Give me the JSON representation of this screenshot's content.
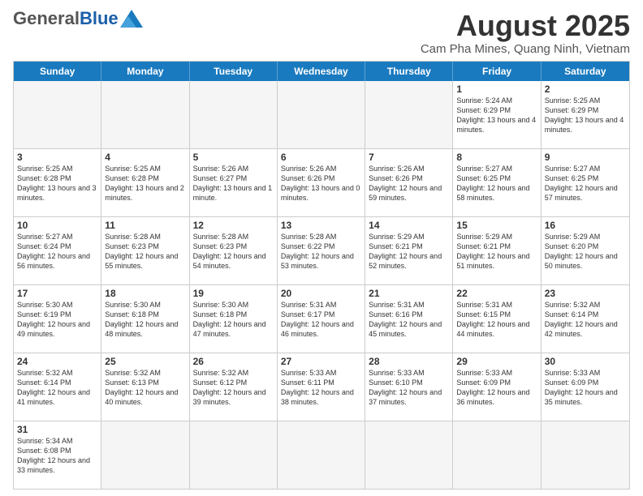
{
  "header": {
    "logo": {
      "general": "General",
      "blue": "Blue"
    },
    "title": "August 2025",
    "location": "Cam Pha Mines, Quang Ninh, Vietnam"
  },
  "calendar": {
    "days_of_week": [
      "Sunday",
      "Monday",
      "Tuesday",
      "Wednesday",
      "Thursday",
      "Friday",
      "Saturday"
    ],
    "weeks": [
      [
        {
          "day": "",
          "info": "",
          "empty": true
        },
        {
          "day": "",
          "info": "",
          "empty": true
        },
        {
          "day": "",
          "info": "",
          "empty": true
        },
        {
          "day": "",
          "info": "",
          "empty": true
        },
        {
          "day": "",
          "info": "",
          "empty": true
        },
        {
          "day": "1",
          "info": "Sunrise: 5:24 AM\nSunset: 6:29 PM\nDaylight: 13 hours\nand 4 minutes.",
          "empty": false
        },
        {
          "day": "2",
          "info": "Sunrise: 5:25 AM\nSunset: 6:29 PM\nDaylight: 13 hours\nand 4 minutes.",
          "empty": false
        }
      ],
      [
        {
          "day": "3",
          "info": "Sunrise: 5:25 AM\nSunset: 6:28 PM\nDaylight: 13 hours\nand 3 minutes.",
          "empty": false
        },
        {
          "day": "4",
          "info": "Sunrise: 5:25 AM\nSunset: 6:28 PM\nDaylight: 13 hours\nand 2 minutes.",
          "empty": false
        },
        {
          "day": "5",
          "info": "Sunrise: 5:26 AM\nSunset: 6:27 PM\nDaylight: 13 hours\nand 1 minute.",
          "empty": false
        },
        {
          "day": "6",
          "info": "Sunrise: 5:26 AM\nSunset: 6:26 PM\nDaylight: 13 hours\nand 0 minutes.",
          "empty": false
        },
        {
          "day": "7",
          "info": "Sunrise: 5:26 AM\nSunset: 6:26 PM\nDaylight: 12 hours\nand 59 minutes.",
          "empty": false
        },
        {
          "day": "8",
          "info": "Sunrise: 5:27 AM\nSunset: 6:25 PM\nDaylight: 12 hours\nand 58 minutes.",
          "empty": false
        },
        {
          "day": "9",
          "info": "Sunrise: 5:27 AM\nSunset: 6:25 PM\nDaylight: 12 hours\nand 57 minutes.",
          "empty": false
        }
      ],
      [
        {
          "day": "10",
          "info": "Sunrise: 5:27 AM\nSunset: 6:24 PM\nDaylight: 12 hours\nand 56 minutes.",
          "empty": false
        },
        {
          "day": "11",
          "info": "Sunrise: 5:28 AM\nSunset: 6:23 PM\nDaylight: 12 hours\nand 55 minutes.",
          "empty": false
        },
        {
          "day": "12",
          "info": "Sunrise: 5:28 AM\nSunset: 6:23 PM\nDaylight: 12 hours\nand 54 minutes.",
          "empty": false
        },
        {
          "day": "13",
          "info": "Sunrise: 5:28 AM\nSunset: 6:22 PM\nDaylight: 12 hours\nand 53 minutes.",
          "empty": false
        },
        {
          "day": "14",
          "info": "Sunrise: 5:29 AM\nSunset: 6:21 PM\nDaylight: 12 hours\nand 52 minutes.",
          "empty": false
        },
        {
          "day": "15",
          "info": "Sunrise: 5:29 AM\nSunset: 6:21 PM\nDaylight: 12 hours\nand 51 minutes.",
          "empty": false
        },
        {
          "day": "16",
          "info": "Sunrise: 5:29 AM\nSunset: 6:20 PM\nDaylight: 12 hours\nand 50 minutes.",
          "empty": false
        }
      ],
      [
        {
          "day": "17",
          "info": "Sunrise: 5:30 AM\nSunset: 6:19 PM\nDaylight: 12 hours\nand 49 minutes.",
          "empty": false
        },
        {
          "day": "18",
          "info": "Sunrise: 5:30 AM\nSunset: 6:18 PM\nDaylight: 12 hours\nand 48 minutes.",
          "empty": false
        },
        {
          "day": "19",
          "info": "Sunrise: 5:30 AM\nSunset: 6:18 PM\nDaylight: 12 hours\nand 47 minutes.",
          "empty": false
        },
        {
          "day": "20",
          "info": "Sunrise: 5:31 AM\nSunset: 6:17 PM\nDaylight: 12 hours\nand 46 minutes.",
          "empty": false
        },
        {
          "day": "21",
          "info": "Sunrise: 5:31 AM\nSunset: 6:16 PM\nDaylight: 12 hours\nand 45 minutes.",
          "empty": false
        },
        {
          "day": "22",
          "info": "Sunrise: 5:31 AM\nSunset: 6:15 PM\nDaylight: 12 hours\nand 44 minutes.",
          "empty": false
        },
        {
          "day": "23",
          "info": "Sunrise: 5:32 AM\nSunset: 6:14 PM\nDaylight: 12 hours\nand 42 minutes.",
          "empty": false
        }
      ],
      [
        {
          "day": "24",
          "info": "Sunrise: 5:32 AM\nSunset: 6:14 PM\nDaylight: 12 hours\nand 41 minutes.",
          "empty": false
        },
        {
          "day": "25",
          "info": "Sunrise: 5:32 AM\nSunset: 6:13 PM\nDaylight: 12 hours\nand 40 minutes.",
          "empty": false
        },
        {
          "day": "26",
          "info": "Sunrise: 5:32 AM\nSunset: 6:12 PM\nDaylight: 12 hours\nand 39 minutes.",
          "empty": false
        },
        {
          "day": "27",
          "info": "Sunrise: 5:33 AM\nSunset: 6:11 PM\nDaylight: 12 hours\nand 38 minutes.",
          "empty": false
        },
        {
          "day": "28",
          "info": "Sunrise: 5:33 AM\nSunset: 6:10 PM\nDaylight: 12 hours\nand 37 minutes.",
          "empty": false
        },
        {
          "day": "29",
          "info": "Sunrise: 5:33 AM\nSunset: 6:09 PM\nDaylight: 12 hours\nand 36 minutes.",
          "empty": false
        },
        {
          "day": "30",
          "info": "Sunrise: 5:33 AM\nSunset: 6:09 PM\nDaylight: 12 hours\nand 35 minutes.",
          "empty": false
        }
      ],
      [
        {
          "day": "31",
          "info": "Sunrise: 5:34 AM\nSunset: 6:08 PM\nDaylight: 12 hours\nand 33 minutes.",
          "empty": false
        },
        {
          "day": "",
          "info": "",
          "empty": true
        },
        {
          "day": "",
          "info": "",
          "empty": true
        },
        {
          "day": "",
          "info": "",
          "empty": true
        },
        {
          "day": "",
          "info": "",
          "empty": true
        },
        {
          "day": "",
          "info": "",
          "empty": true
        },
        {
          "day": "",
          "info": "",
          "empty": true
        }
      ]
    ]
  }
}
